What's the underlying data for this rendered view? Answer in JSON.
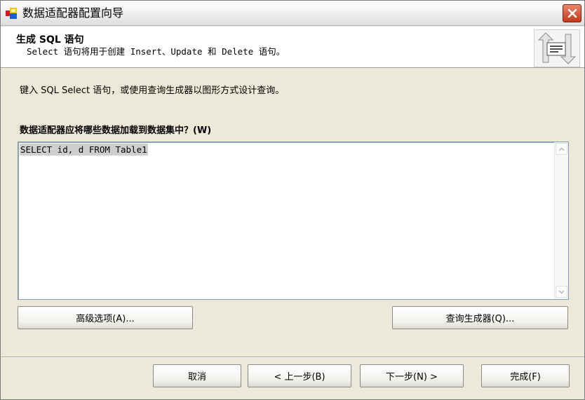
{
  "window": {
    "title": "数据适配器配置向导",
    "close_label": "✕"
  },
  "header": {
    "title": "生成 SQL 语句",
    "subtitle": "Select 语句将用于创建 Insert、Update 和 Delete 语句。"
  },
  "body": {
    "instruction": "键入 SQL Select 语句，或使用查询生成器以图形方式设计查询。",
    "question": "数据适配器应将哪些数据加载到数据集中？(W)",
    "sql_value": "SELECT id, d FROM Table1"
  },
  "actions": {
    "advanced_label": "高级选项(A)...",
    "query_builder_label": "查询生成器(Q)..."
  },
  "footer": {
    "cancel_label": "取消",
    "back_label": "< 上一步(B)",
    "next_label": "下一步(N) >",
    "finish_label": "完成(F)"
  },
  "colors": {
    "window_bg": "#ece9d8",
    "close_button": "#c4391a",
    "input_border": "#7f9db9"
  },
  "icons": {
    "app": "data-adapter-icon",
    "header": "database-sync-icon",
    "close": "close-icon",
    "scroll_up": "chevron-up-icon",
    "scroll_down": "chevron-down-icon"
  }
}
